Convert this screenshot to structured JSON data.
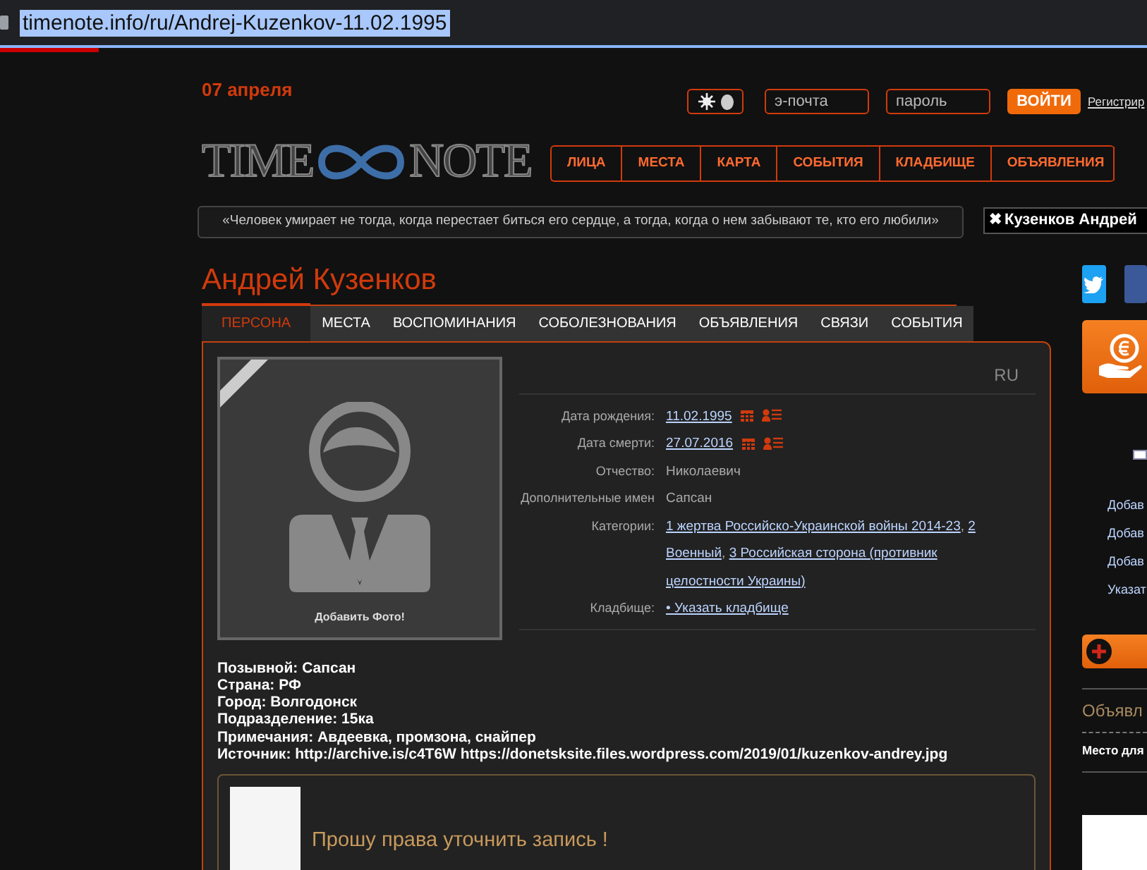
{
  "address_bar": {
    "url": "timenote.info/ru/Andrej-Kuzenkov-11.02.1995"
  },
  "header": {
    "date": "07 апреля",
    "theme_toggle": {
      "dark": true
    },
    "email_placeholder": "э-почта",
    "password_placeholder": "пароль",
    "login_button": "ВОЙТИ",
    "register_link": "Регистрир",
    "logo_left": "TIME",
    "logo_right": "NOTE"
  },
  "nav": [
    {
      "label": "ЛИЦА"
    },
    {
      "label": "МЕСТА"
    },
    {
      "label": "КАРТА"
    },
    {
      "label": "СОБЫТИЯ"
    },
    {
      "label": "КЛАДБИЩЕ"
    },
    {
      "label": "ОБЪЯВЛЕНИЯ"
    }
  ],
  "quote": "«Человек умирает не тогда, когда перестает биться его сердце, а тогда, когда о нем забывают те, кто его любили»",
  "recent_person": {
    "icon": "✖",
    "name": "Кузенков Андрей"
  },
  "person_name": "Андрей Кузенков",
  "tabs": [
    {
      "label": "ПЕРСОНА",
      "selected": true
    },
    {
      "label": "МЕСТА",
      "selected": false
    },
    {
      "label": "ВОСПОМИНАНИЯ",
      "selected": false
    },
    {
      "label": "СОБОЛЕЗНОВАНИЯ",
      "selected": false
    },
    {
      "label": "ОБЪЯВЛЕНИЯ",
      "selected": false
    },
    {
      "label": "СВЯЗИ",
      "selected": false
    },
    {
      "label": "СОБЫТИЯ",
      "selected": false
    }
  ],
  "photo": {
    "caption": "Добавить Фото!"
  },
  "language": "RU",
  "details": [
    {
      "label": "Дата рождения:",
      "kind": "date",
      "link": "11.02.1995"
    },
    {
      "label": "Дата смерти:",
      "kind": "date",
      "link": "27.07.2016"
    },
    {
      "label": "Отчество:",
      "kind": "text",
      "value": "Николаевич"
    },
    {
      "label": "Дополнительные имен",
      "kind": "text",
      "value": "Сапсан"
    },
    {
      "label": "Категории:",
      "kind": "links",
      "lines": [
        [
          {
            "text": "1 жертва Российско-Украинской войны 2014-23",
            "sep": ","
          },
          {
            "text": "2"
          }
        ],
        [
          {
            "text": "Военный",
            "sep": ","
          },
          {
            "text": "3 Российская сторона (противник"
          }
        ],
        [
          {
            "text": "целостности Украины)"
          }
        ]
      ]
    },
    {
      "label": "Кладбище:",
      "kind": "links",
      "lines": [
        [
          {
            "text": "• Указать кладбище"
          }
        ]
      ]
    }
  ],
  "bio": [
    "Позывной: Сапсан",
    "Страна: РФ",
    "Город: Волгодонск",
    "Подразделение: 15ка",
    "Примечания: Авдеевка, промзона, снайпер",
    "Источник: http://archive.is/c4T6W https://donetsksite.files.wordpress.com/2019/01/kuzenkov-andrey.jpg"
  ],
  "request": {
    "text": "Прошу права уточнить запись !"
  },
  "sidebar": {
    "links": [
      "Добав",
      "Добав",
      "Добав",
      "Указат"
    ],
    "ads_title": "Объявл",
    "ads_text": "Место для"
  }
}
